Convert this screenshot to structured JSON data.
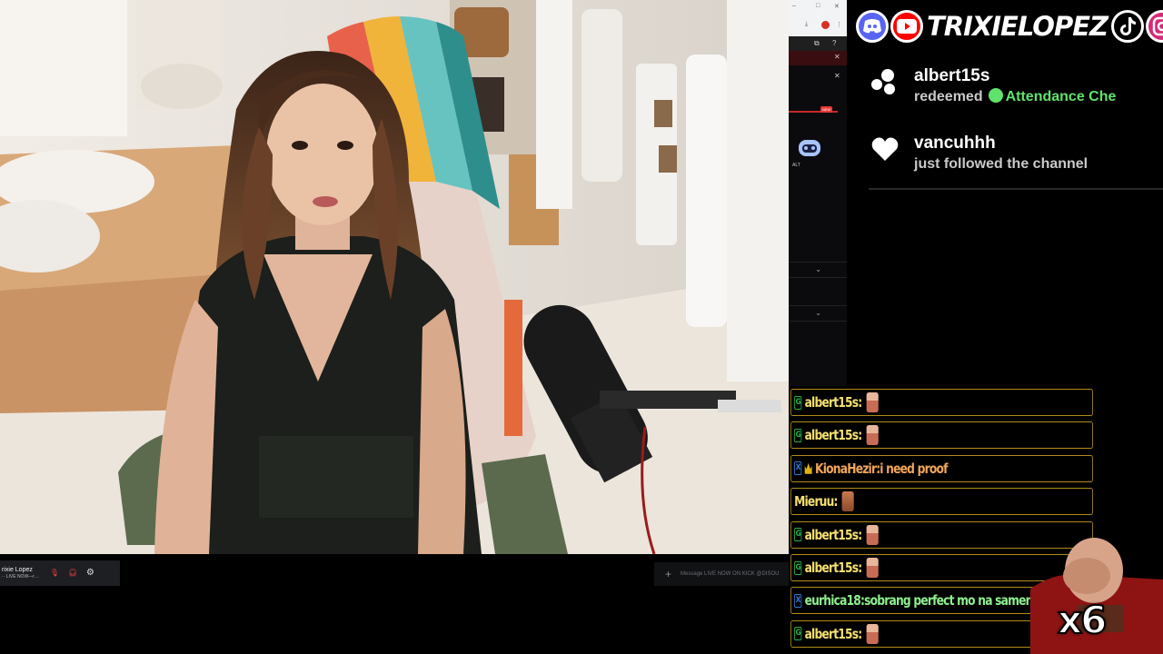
{
  "banner": {
    "name": "TRIXIELOPEZ",
    "icons": [
      "discord-icon",
      "youtube-icon",
      "tiktok-icon",
      "instagram-icon",
      "facebook-icon"
    ],
    "colors": {
      "discord": "#5865f2",
      "youtube": "#ff0000",
      "tiktok": "#000000",
      "instagram": "#d62976",
      "facebook": "#1877f2"
    }
  },
  "alerts": [
    {
      "icon": "channel-points-icon",
      "user": "albert15s",
      "action": "redeemed",
      "reward": "Attendance Che"
    },
    {
      "icon": "heart-icon",
      "user": "vancuhhh",
      "action": "just followed the channel"
    }
  ],
  "chat": [
    {
      "badge": "gift",
      "user": "albert15s",
      "sep": " :",
      "text": "",
      "emote": "a",
      "color": "#f6e070"
    },
    {
      "badge": "gift",
      "user": "albert15s",
      "sep": " :",
      "text": "",
      "emote": "a",
      "color": "#f6e070"
    },
    {
      "badge": "gift-blue",
      "crown": true,
      "user": "KionaHezir",
      "sep": " :",
      "text": " i need proof",
      "color": "#f2a65a"
    },
    {
      "badge": "",
      "user": "Mieruu",
      "sep": " :",
      "text": "",
      "emote": "b",
      "color": "#f6e070"
    },
    {
      "badge": "gift",
      "user": "albert15s",
      "sep": " :",
      "text": "",
      "emote": "a",
      "color": "#f6e070"
    },
    {
      "badge": "gift",
      "user": "albert15s",
      "sep": " :",
      "text": "",
      "emote": "a",
      "color": "#f6e070"
    },
    {
      "badge": "gift-blue",
      "user": "eurhica18",
      "sep": " :",
      "text": " sobrang perfect mo na samen mommy",
      "color": "#8ef08e"
    },
    {
      "badge": "gift",
      "user": "albert15s",
      "sep": " :",
      "text": "",
      "emote": "a",
      "color": "#f6e070"
    }
  ],
  "meme": {
    "multiplier": "x6"
  },
  "discord": {
    "username": "rixie Lopez",
    "status": "·· LIVE NOW—r…",
    "message_placeholder": "Message LIVE NOW ON KICK @DISOU"
  },
  "browser": {
    "robot_label": "ALT",
    "new_badge": "NEW"
  }
}
